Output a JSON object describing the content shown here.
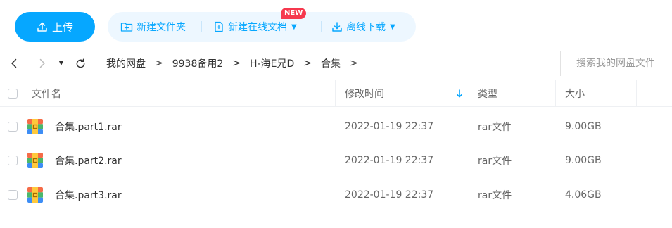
{
  "toolbar": {
    "upload_label": "上传",
    "new_folder_label": "新建文件夹",
    "new_online_doc_label": "新建在线文档",
    "new_badge": "NEW",
    "offline_download_label": "离线下载"
  },
  "nav": {
    "breadcrumb": [
      "我的网盘",
      "9938备用2",
      "H-海E兄D",
      "合集"
    ],
    "search_placeholder": "搜索我的网盘文件"
  },
  "table": {
    "columns": {
      "name": "文件名",
      "modified": "修改时间",
      "type": "类型",
      "size": "大小"
    },
    "sort": {
      "column": "modified",
      "direction": "desc"
    },
    "rows": [
      {
        "name": "合集.part1.rar",
        "modified": "2022-01-19 22:37",
        "type": "rar文件",
        "size": "9.00GB",
        "icon": "rar-archive-icon"
      },
      {
        "name": "合集.part2.rar",
        "modified": "2022-01-19 22:37",
        "type": "rar文件",
        "size": "9.00GB",
        "icon": "rar-archive-icon"
      },
      {
        "name": "合集.part3.rar",
        "modified": "2022-01-19 22:37",
        "type": "rar文件",
        "size": "4.06GB",
        "icon": "rar-archive-icon"
      }
    ]
  },
  "colors": {
    "accent": "#06a7ff",
    "accent_soft": "#edf7ff",
    "badge": "#f6384e"
  }
}
